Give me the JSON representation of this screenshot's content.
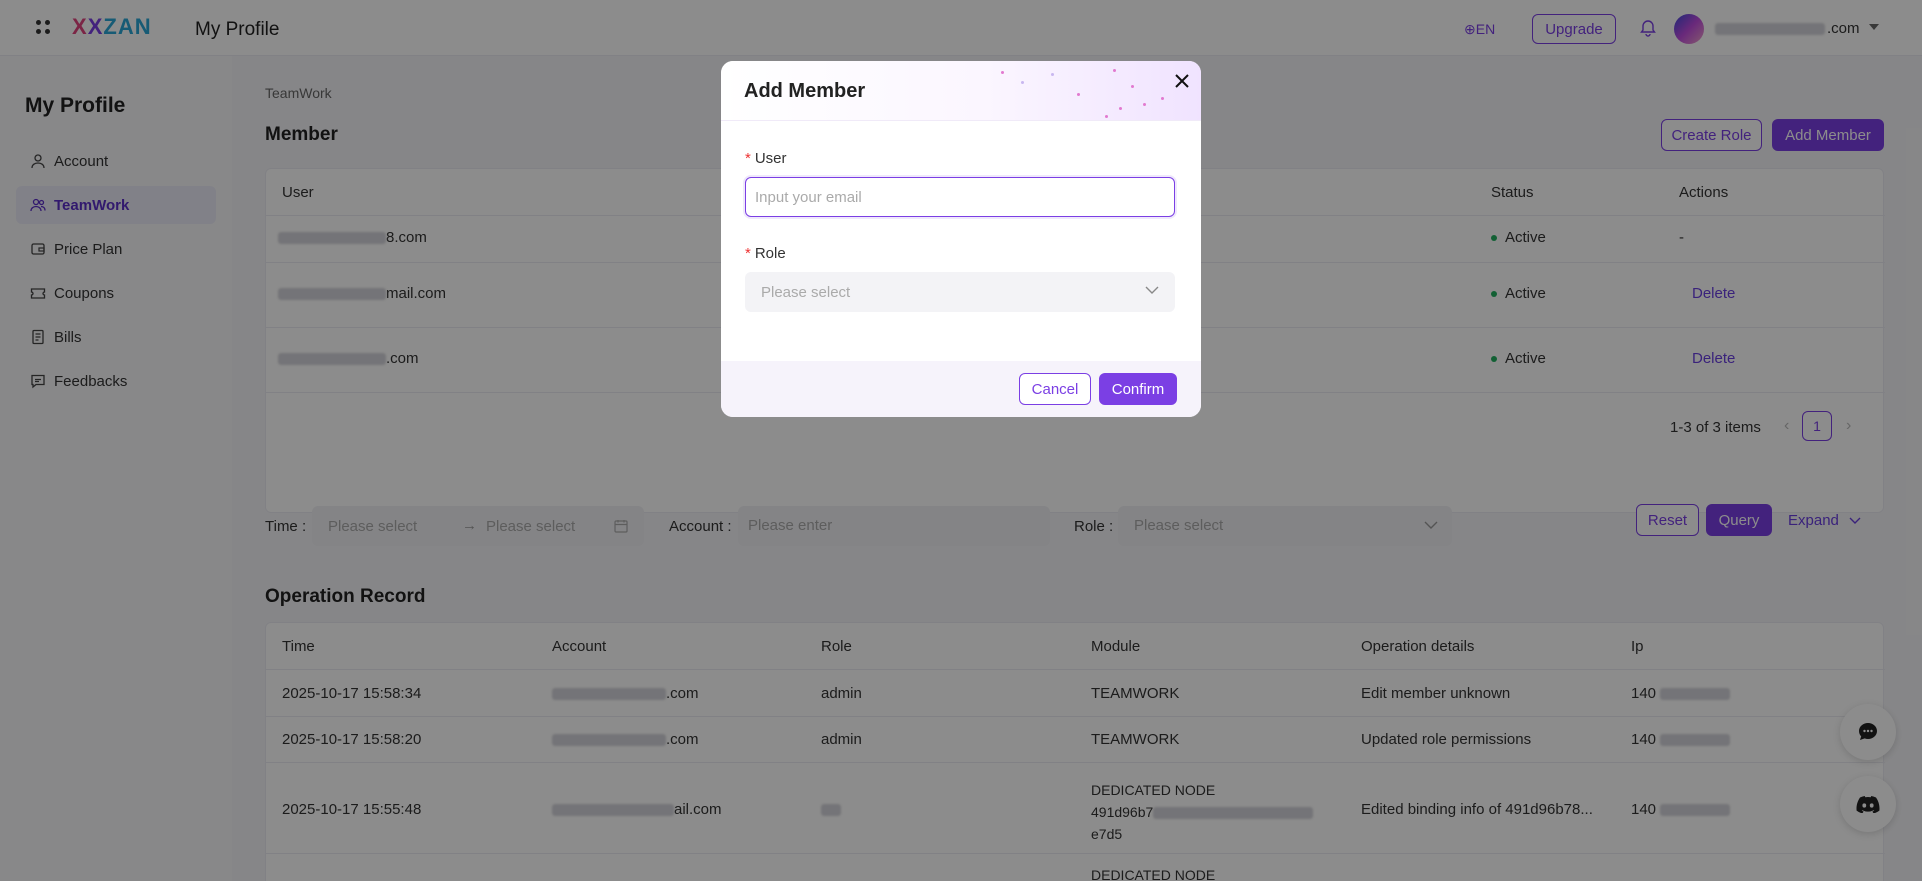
{
  "header": {
    "title": "My Profile",
    "language": "EN",
    "upgrade_label": "Upgrade",
    "user_email_suffix": ".com"
  },
  "sidebar": {
    "title": "My Profile",
    "items": [
      {
        "label": "Account",
        "icon": "user-icon"
      },
      {
        "label": "TeamWork",
        "icon": "team-icon",
        "active": true
      },
      {
        "label": "Price Plan",
        "icon": "wallet-icon"
      },
      {
        "label": "Coupons",
        "icon": "coupon-icon"
      },
      {
        "label": "Bills",
        "icon": "bill-icon"
      },
      {
        "label": "Feedbacks",
        "icon": "feedback-icon"
      }
    ]
  },
  "breadcrumb": "TeamWork",
  "member": {
    "title": "Member",
    "create_role_label": "Create Role",
    "add_member_label": "Add Member",
    "columns": [
      "User",
      "Status",
      "Actions"
    ],
    "rows": [
      {
        "user_suffix": "8.com",
        "status": "Active",
        "action": "-"
      },
      {
        "user_suffix": "mail.com",
        "status": "Active",
        "action": "Delete"
      },
      {
        "user_suffix": ".com",
        "status": "Active",
        "action": "Delete"
      }
    ],
    "pagination_text": "1-3 of 3 items",
    "current_page": "1"
  },
  "filters": {
    "time_label": "Time :",
    "time_start_placeholder": "Please select",
    "time_end_placeholder": "Please select",
    "account_label": "Account :",
    "account_placeholder": "Please enter",
    "role_label": "Role :",
    "role_placeholder": "Please select",
    "reset_label": "Reset",
    "query_label": "Query",
    "expand_label": "Expand"
  },
  "operation_record": {
    "title": "Operation Record",
    "columns": [
      "Time",
      "Account",
      "Role",
      "Module",
      "Operation details",
      "Ip"
    ],
    "rows": [
      {
        "time": "2025-10-17 15:58:34",
        "account_suffix": ".com",
        "role": "admin",
        "module": "TEAMWORK",
        "details": "Edit member unknown",
        "ip_prefix": "140"
      },
      {
        "time": "2025-10-17 15:58:20",
        "account_suffix": ".com",
        "role": "admin",
        "module": "TEAMWORK",
        "details": "Updated role permissions",
        "ip_prefix": "140"
      },
      {
        "time": "2025-10-17 15:55:48",
        "account_suffix": "ail.com",
        "role": "",
        "module_line1": "DEDICATED NODE",
        "module_line2": "491d96b7",
        "module_line3": "e7d5",
        "details": "Edited binding info of 491d96b78...",
        "ip_prefix": "140"
      }
    ],
    "partial_row_module": "DEDICATED NODE"
  },
  "modal": {
    "title": "Add Member",
    "user_label": "User",
    "user_placeholder": "Input your email",
    "role_label": "Role",
    "role_placeholder": "Please select",
    "cancel_label": "Cancel",
    "confirm_label": "Confirm"
  },
  "colors": {
    "accent": "#7b3fe4",
    "status_active": "#22b060"
  }
}
